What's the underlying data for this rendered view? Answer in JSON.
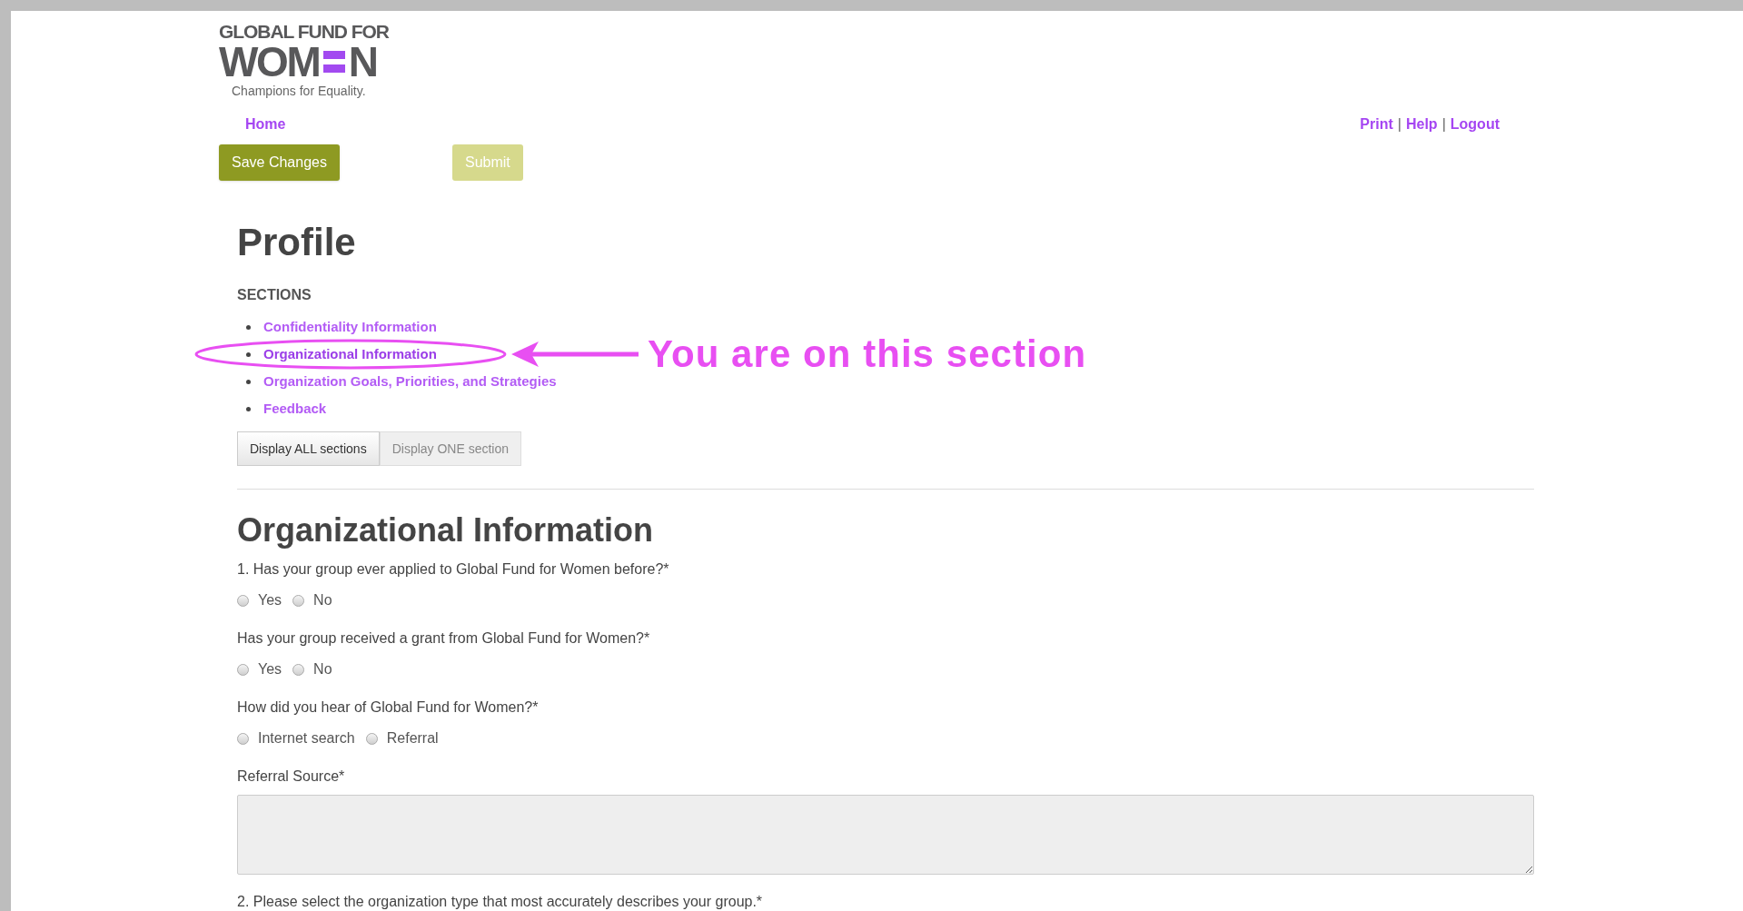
{
  "logo": {
    "line1": "GLOBAL FUND FOR",
    "word_start": "WOM",
    "word_end": "N",
    "tagline": "Champions for Equality."
  },
  "nav": {
    "home": "Home",
    "links": [
      "Print",
      "Help",
      "Logout"
    ],
    "separator": "|"
  },
  "actions": [
    {
      "label": "Save Changes",
      "disabled": false
    },
    {
      "label": "Submit",
      "disabled": true
    }
  ],
  "page_title": "Profile",
  "sections": {
    "heading": "SECTIONS",
    "items": [
      {
        "label": "Confidentiality Information",
        "selected": false
      },
      {
        "label": "Organizational Information",
        "selected": true
      },
      {
        "label": "Organization Goals, Priorities, and Strategies",
        "selected": false
      },
      {
        "label": "Feedback",
        "selected": false
      }
    ]
  },
  "display_toggle": [
    {
      "label": "Display ALL sections",
      "selected": true
    },
    {
      "label": "Display ONE section",
      "selected": false
    }
  ],
  "annotation": {
    "text": "You are on this section"
  },
  "form": {
    "title": "Organizational Information",
    "questions": [
      {
        "kind": "radio",
        "label": "1. Has your group ever applied to Global Fund for Women before?*",
        "options": [
          {
            "label": "Yes",
            "checked": false
          },
          {
            "label": "No",
            "checked": false
          }
        ]
      },
      {
        "kind": "radio",
        "label": "Has your group received a grant from Global Fund for Women?*",
        "options": [
          {
            "label": "Yes",
            "checked": false
          },
          {
            "label": "No",
            "checked": false
          }
        ]
      },
      {
        "kind": "radio",
        "label": "How did you hear of Global Fund for Women?*",
        "options": [
          {
            "label": "Internet search",
            "checked": false
          },
          {
            "label": "Referral",
            "checked": false
          }
        ]
      },
      {
        "kind": "textarea",
        "label": "Referral Source*"
      },
      {
        "kind": "label",
        "label": "2. Please select the organization type that most accurately describes your group.*"
      }
    ]
  }
}
